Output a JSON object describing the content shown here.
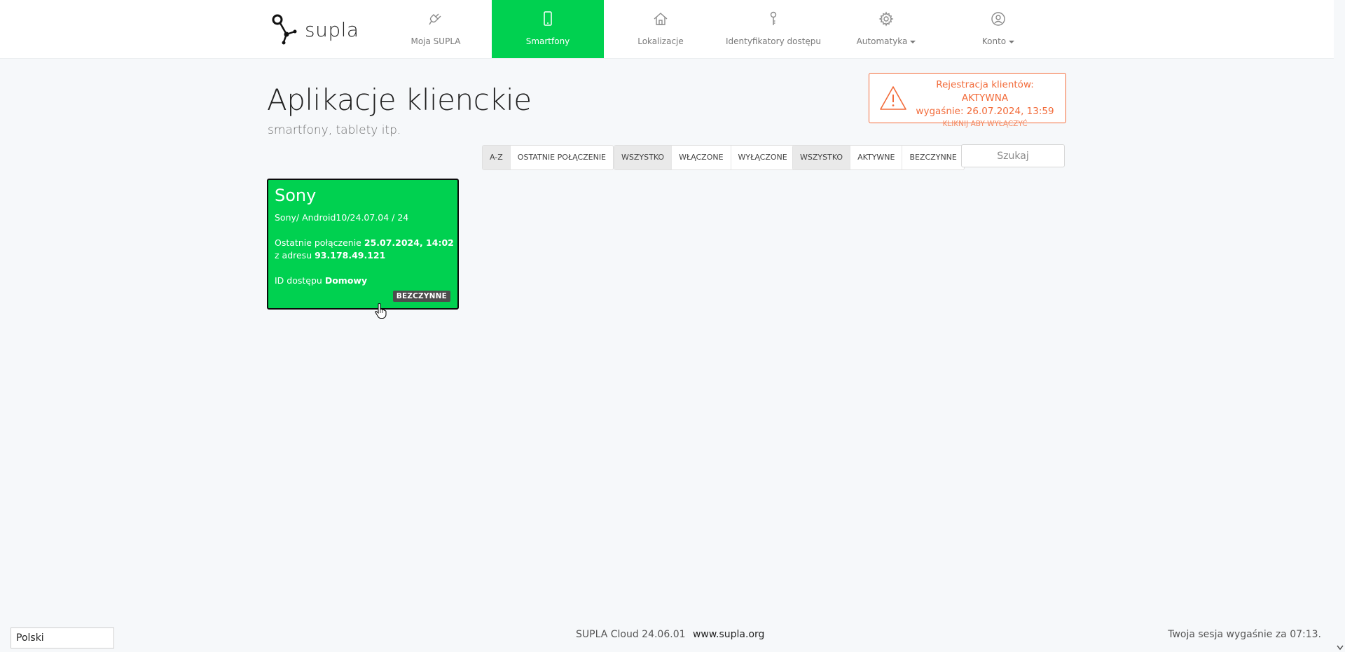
{
  "app": {
    "logo_text": "supla"
  },
  "nav": [
    {
      "label": "Moja SUPLA",
      "icon": "plug-icon"
    },
    {
      "label": "Smartfony",
      "icon": "smartphone-icon",
      "active": true
    },
    {
      "label": "Lokalizacje",
      "icon": "home-icon"
    },
    {
      "label": "Identyfikatory dostępu",
      "icon": "key-icon"
    },
    {
      "label": "Automatyka",
      "icon": "gear-icon",
      "dropdown": true
    },
    {
      "label": "Konto",
      "icon": "user-icon",
      "dropdown": true
    }
  ],
  "header": {
    "title": "Aplikacje klienckie",
    "subtitle": "smartfony, tablety itp."
  },
  "alert": {
    "line1": "Rejestracja klientów: AKTYWNA",
    "line2": "wygaśnie: 26.07.2024, 13:59",
    "line3": "KLIKNIJ ABY WYŁĄCZYĆ",
    "color": "#f26b3a"
  },
  "filters": {
    "sort": [
      "A-Z",
      "OSTATNIE POŁĄCZENIE"
    ],
    "enabled": [
      "WSZYSTKO",
      "WŁĄCZONE",
      "WYŁĄCZONE"
    ],
    "activity": [
      "WSZYSTKO",
      "AKTYWNE",
      "BEZCZYNNE"
    ],
    "search_placeholder": "Szukaj"
  },
  "clients": [
    {
      "name": "Sony",
      "software": "Sony/ Android10/24.07.04 / 24",
      "last_conn_label": "Ostatnie połączenie",
      "last_conn_value": "25.07.2024, 14:02",
      "address_label": "z adresu",
      "address_value": "93.178.49.121",
      "access_label": "ID dostępu",
      "access_value": "Domowy",
      "status": "BEZCZYNNE",
      "color": "#00d150"
    }
  ],
  "footer": {
    "language": "Polski",
    "version": "SUPLA Cloud 24.06.01",
    "link": "www.supla.org",
    "session": "Twoja sesja wygaśnie za 07:13."
  }
}
